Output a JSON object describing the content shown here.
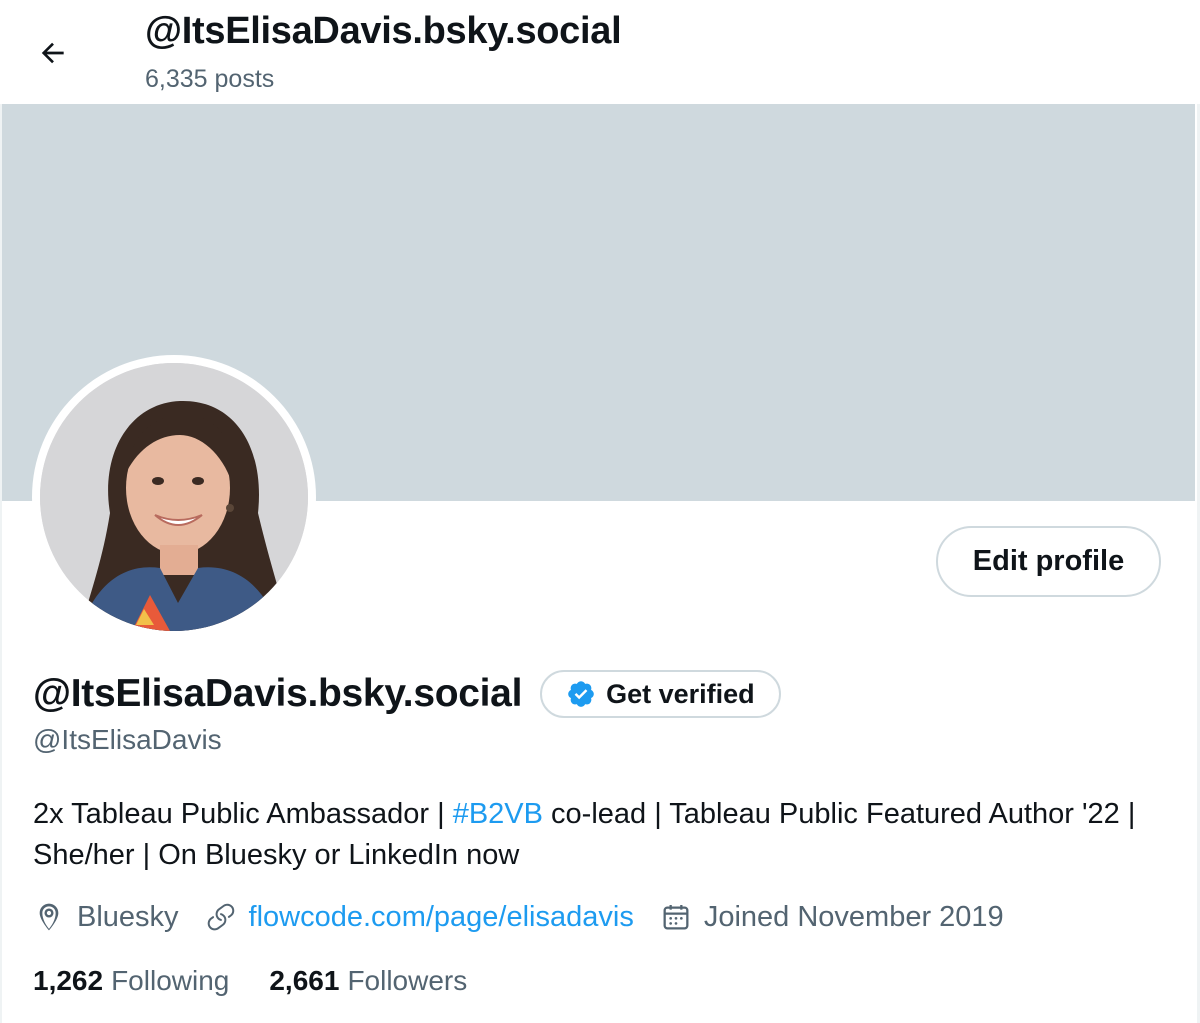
{
  "header": {
    "title": "@ItsElisaDavis.bsky.social",
    "posts_count": "6,335 posts"
  },
  "profile": {
    "display_name": "@ItsElisaDavis.bsky.social",
    "handle": "@ItsElisaDavis",
    "verify_label": "Get verified",
    "edit_label": "Edit profile",
    "bio": {
      "part1": "2x Tableau Public Ambassador | ",
      "hashtag": "#B2VB",
      "part2": " co-lead | Tableau Public Featured Author '22 | She/her | On Bluesky or LinkedIn now"
    },
    "location": "Bluesky",
    "website": "flowcode.com/page/elisadavis",
    "joined": "Joined November 2019",
    "following_count": "1,262",
    "following_label": "Following",
    "followers_count": "2,661",
    "followers_label": "Followers"
  },
  "icons": {
    "back": "arrow-left-icon",
    "verified": "verified-badge-icon",
    "location": "location-pin-icon",
    "link": "link-icon",
    "calendar": "calendar-icon"
  },
  "colors": {
    "accent": "#1d9bf0",
    "banner": "#cfd9de",
    "secondary_text": "#536471",
    "primary_text": "#0f1419",
    "border": "#cfd9de"
  }
}
